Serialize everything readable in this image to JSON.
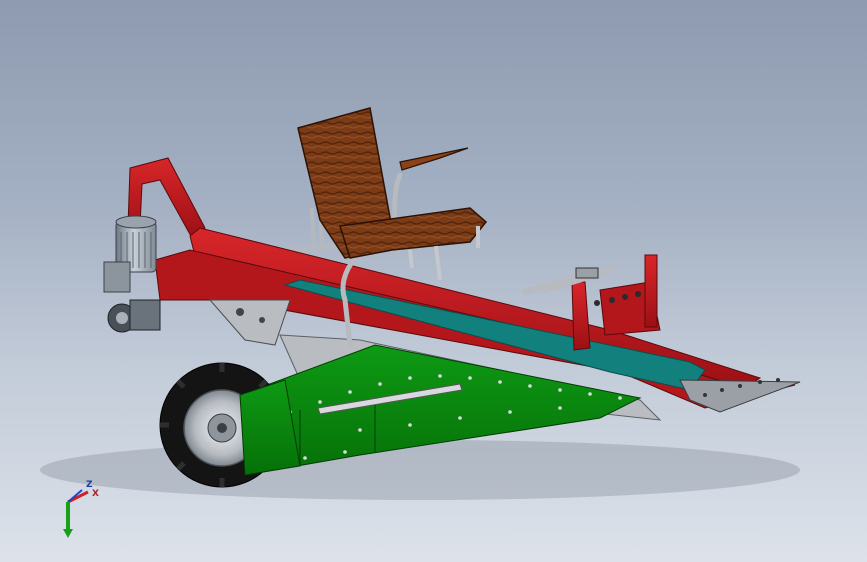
{
  "viewport": {
    "background_top": "#8e9bb0",
    "background_bottom": "#dde2ea"
  },
  "model": {
    "colors": {
      "frame_red": "#c0161c",
      "frame_red_dark": "#8a0d12",
      "body_green": "#0a8a10",
      "body_green_dark": "#056408",
      "belt_teal": "#12807c",
      "steel": "#b9bcc0",
      "tire": "#1a1a1a",
      "seat_wood": "#7a3b16"
    },
    "parts": [
      "motor",
      "gearbox",
      "frame-arm",
      "conveyor-frame",
      "seat",
      "armrest",
      "wheel",
      "side-panel",
      "blade",
      "control-post"
    ]
  },
  "triad": {
    "z_label": "Z",
    "x_label": "X",
    "x_color": "#cc2222",
    "y_color": "#18a018",
    "z_color": "#2244cc"
  }
}
